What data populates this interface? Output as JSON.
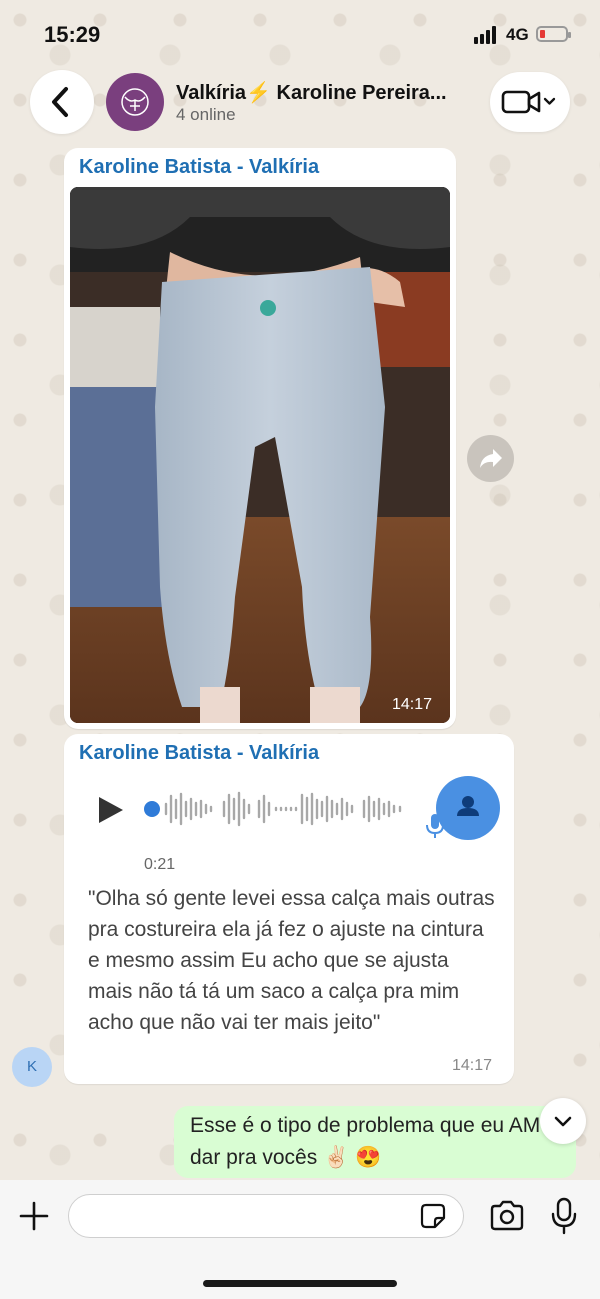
{
  "status_bar": {
    "time": "15:29",
    "network": "4G"
  },
  "header": {
    "title": "Valkíria⚡️ Karoline Pereira...",
    "subtitle": "4 online"
  },
  "messages": {
    "photo_msg": {
      "sender": "Karoline Batista - Valkíria",
      "time": "14:17"
    },
    "voice_msg": {
      "sender": "Karoline Batista - Valkíria",
      "duration": "0:21",
      "transcript": "\"Olha só gente levei essa calça mais outras pra costureira ela já fez o ajuste na cintura e mesmo assim Eu acho que se ajusta mais não tá tá um saco a calça pra mim acho que não vai ter mais jeito\"",
      "time": "14:17"
    },
    "sender_avatar_initial": "K",
    "outgoing_msg": {
      "text": "Esse é o tipo de problema que eu AMO dar pra vocês ✌🏻 😍"
    }
  },
  "composer": {
    "placeholder": ""
  },
  "colors": {
    "accent_blue": "#1f6fb3",
    "outgoing_bubble": "#d9fdd3",
    "battery_low": "#e53935"
  }
}
